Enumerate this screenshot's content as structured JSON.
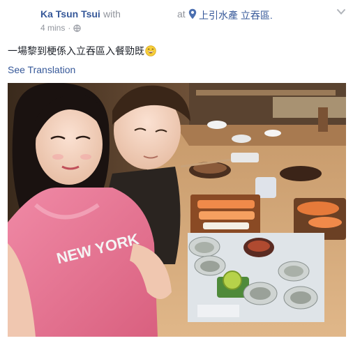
{
  "post": {
    "author": "Ka Tsun Tsui",
    "with_text": "with",
    "at_text": "at",
    "place": "上引水產 立吞區.",
    "time": "4 mins",
    "separator": "·",
    "status_text": "一場黎到梗係入立吞區入餐勁既",
    "see_translation": "See Translation"
  },
  "photo": {
    "shirt_text": "NEW YORK"
  },
  "icons": {
    "location": "map-pin-icon",
    "privacy": "globe-icon",
    "menu": "chevron-down-icon",
    "emoji": "grinning-emoji-icon"
  },
  "colors": {
    "link": "#365899",
    "meta": "#90949c",
    "text": "#1d2129"
  }
}
